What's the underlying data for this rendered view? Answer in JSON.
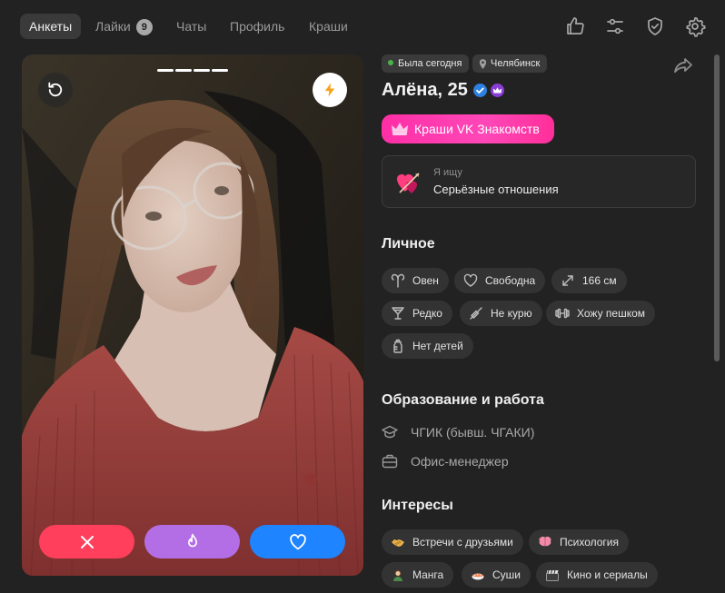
{
  "nav": {
    "tabs": [
      {
        "label": "Анкеты",
        "active": true
      },
      {
        "label": "Лайки",
        "badge": "9"
      },
      {
        "label": "Чаты"
      },
      {
        "label": "Профиль"
      },
      {
        "label": "Краши"
      }
    ],
    "icons": [
      "thumbs-up-icon",
      "filters-icon",
      "shield-check-icon",
      "gear-icon"
    ]
  },
  "photo": {
    "indicator_count": 4,
    "icons": [
      "rewind-icon",
      "lightning-icon"
    ],
    "actions": [
      "close-icon",
      "flame-icon",
      "heart-icon"
    ],
    "colors": {
      "dislike": "#ff3f5b",
      "superlike": "#b36ee6",
      "like": "#1f84ff"
    }
  },
  "profile": {
    "status": "Была сегодня",
    "location": "Челябинск",
    "name": "Алёна, 25",
    "crush_label": "Краши VK Знакомств",
    "seeking_label": "Я ищу",
    "seeking_value": "Серьёзные отношения"
  },
  "sections": {
    "personal": "Личное",
    "education": "Образование и работа",
    "interests": "Интересы"
  },
  "personal_tags": [
    {
      "label": "Овен",
      "icon": "aries-icon"
    },
    {
      "label": "Свободна",
      "icon": "heart-outline-icon"
    },
    {
      "label": "166 см",
      "icon": "height-icon"
    },
    {
      "label": "Редко",
      "icon": "wine-glass-icon"
    },
    {
      "label": "Не курю",
      "icon": "no-smoking-icon"
    },
    {
      "label": "Хожу пешком",
      "icon": "dumbbell-icon"
    },
    {
      "label": "Нет детей",
      "icon": "baby-bottle-icon"
    }
  ],
  "education": [
    {
      "label": "ЧГИК (бывш. ЧГАКИ)",
      "icon": "graduation-cap-icon"
    },
    {
      "label": "Офис-менеджер",
      "icon": "briefcase-icon"
    }
  ],
  "interests": [
    {
      "label": "Встречи с друзьями",
      "icon": "handshake-icon",
      "color": "#e8b04a"
    },
    {
      "label": "Психология",
      "icon": "brain-icon",
      "color": "#f08aa8"
    },
    {
      "label": "Манга",
      "icon": "manga-icon",
      "color": "#c9a06a"
    },
    {
      "label": "Суши",
      "icon": "sushi-icon",
      "color": "#f07a4a"
    },
    {
      "label": "Кино и сериалы",
      "icon": "clapperboard-icon",
      "color": "#9a9a9a"
    }
  ],
  "colors": {
    "background": "#222222",
    "accent_pink": "#ff2fa6",
    "online": "#4bb34b",
    "verified": "#2d81e0",
    "premium": "#8a3cd6"
  }
}
